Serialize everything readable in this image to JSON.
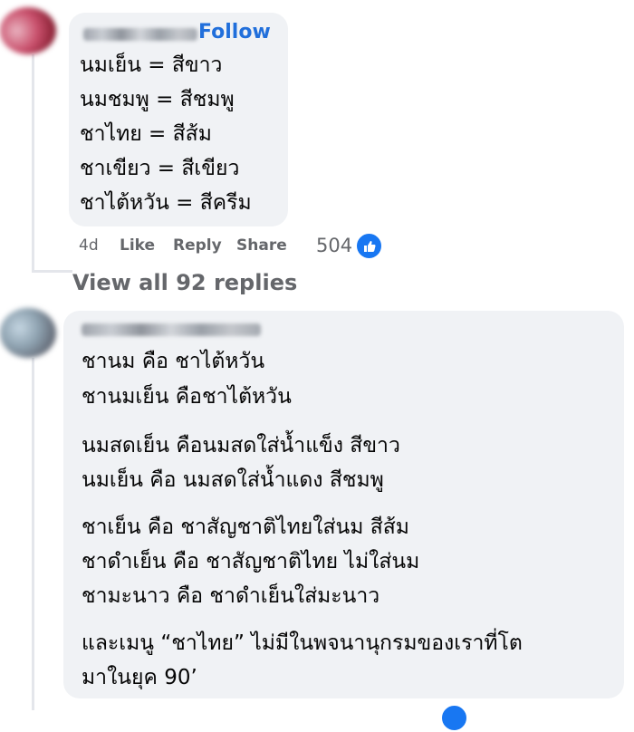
{
  "comment1": {
    "follow_label": "Follow",
    "lines": [
      "นมเย็น = สีขาว",
      "นมชมพู = สีชมพู",
      "ชาไทย = สีส้ม",
      "ชาเขียว = สีเขียว",
      "ชาไต้หวัน = สีครีม"
    ],
    "actions": {
      "time": "4d",
      "like": "Like",
      "reply": "Reply",
      "share": "Share"
    },
    "reaction_count": "504",
    "reaction_icon": "like-icon"
  },
  "replies_link": "View all 92 replies",
  "comment2": {
    "lines": [
      "ชานม คือ ชาไต้หวัน",
      "ชานมเย็น คือชาไต้หวัน",
      "นมสดเย็น คือนมสดใส่น้ำแข็ง สีขาว",
      "นมเย็น คือ นมสดใส่น้ำแดง สีชมพู",
      "ชาเย็น คือ ชาสัญชาติไทยใส่นม สีส้ม",
      "ชาดำเย็น คือ ชาสัญชาติไทย ไม่ใส่นม",
      "ชามะนาว คือ ชาดำเย็นใส่มะนาว",
      "และเมนู “ชาไทย” ไม่มีในพจนานุกรมของเราที่โต",
      "มาในยุค 90’"
    ]
  },
  "colors": {
    "bubble": "#f0f2f5",
    "link_blue": "#216fdb",
    "meta_gray": "#65676b",
    "like_blue": "#1877f2"
  }
}
